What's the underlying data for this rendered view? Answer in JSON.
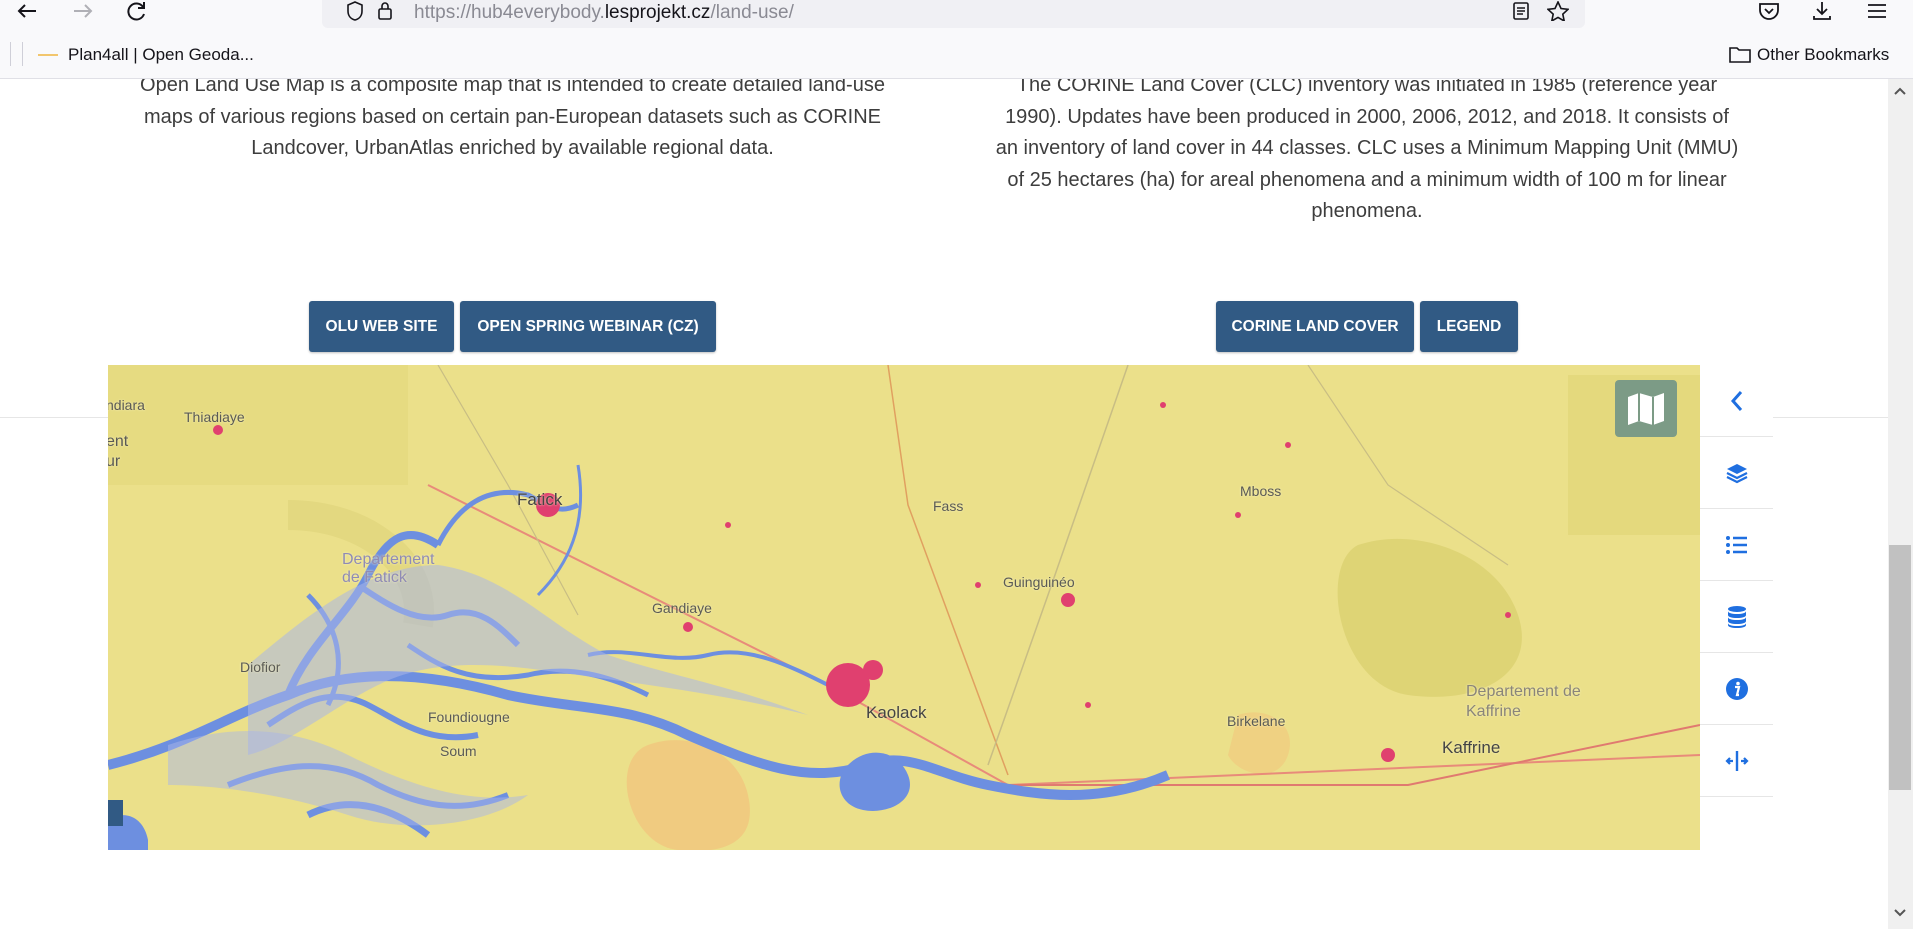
{
  "browser": {
    "url_prefix": "https://hub4everybody.",
    "url_domain": "lesprojekt.cz",
    "url_path": "/land-use/",
    "bookmarks": [
      {
        "label": "Plan4all | Open Geoda..."
      }
    ],
    "other_bookmarks": "Other Bookmarks"
  },
  "left_section": {
    "description": "Open Land Use Map is a composite map that is intended to create detailed land-use maps of various regions based on certain pan-European datasets such as CORINE Landcover, UrbanAtlas enriched by available regional data.",
    "buttons": [
      "OLU WEB SITE",
      "OPEN SPRING WEBINAR (CZ)"
    ]
  },
  "right_section": {
    "description": "The CORINE Land Cover (CLC) inventory was initiated in 1985 (reference year 1990). Updates have been produced in 2000, 2006, 2012, and 2018. It consists of an inventory of land cover in 44 classes. CLC uses a Minimum Mapping Unit (MMU) of 25 hectares (ha) for areal phenomena and a minimum width of 100 m for linear phenomena.",
    "buttons": [
      "CORINE LAND COVER",
      "LEGEND"
    ]
  },
  "map": {
    "places": [
      "Thiadiaye",
      "Fatick",
      "Departement de Fatick",
      "Gandiaye",
      "Diofior",
      "Foundiougne",
      "Soum",
      "Kaolack",
      "Fass",
      "Guinguinéo",
      "Mboss",
      "Birkelane",
      "Departement de Kaffrine",
      "Kaffrine",
      "ndiara",
      "ent",
      "ur"
    ],
    "colors": {
      "water": "#6d8fe0",
      "urban": "#e0406f",
      "land": "#ebe08a"
    }
  },
  "side_panel": {
    "icons": [
      "chevron-left-icon",
      "layers-icon",
      "list-icon",
      "database-icon",
      "info-icon",
      "compare-icon"
    ]
  }
}
